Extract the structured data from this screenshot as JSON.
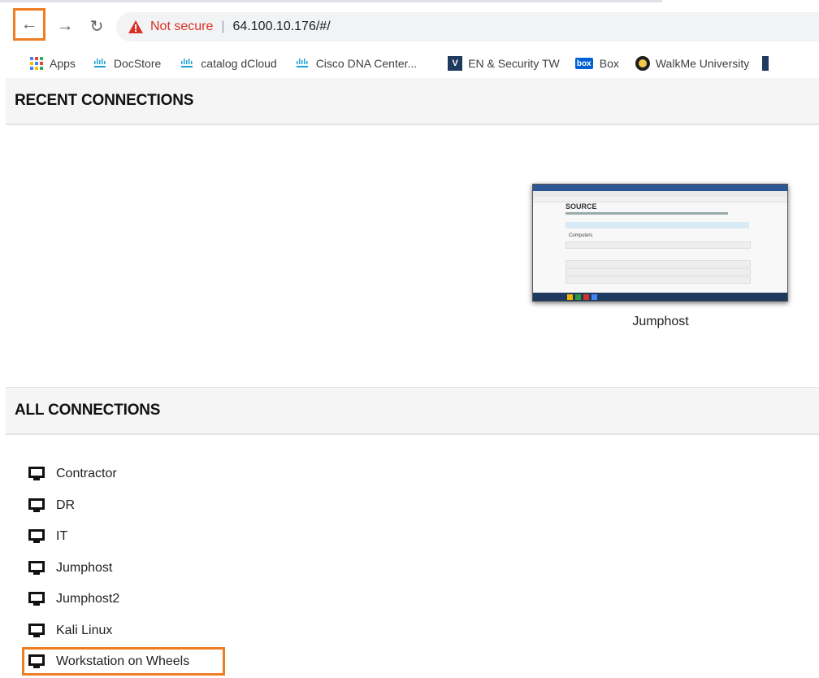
{
  "browser": {
    "security_label": "Not secure",
    "separator": "|",
    "url": "64.100.10.176/#/",
    "bookmarks": [
      {
        "label": "Apps",
        "icon": "apps-grid-icon"
      },
      {
        "label": "DocStore",
        "icon": "cisco-logo-icon"
      },
      {
        "label": "catalog dCloud",
        "icon": "cisco-logo-icon"
      },
      {
        "label": "Cisco DNA Center...",
        "icon": "cisco-logo-icon"
      },
      {
        "label": "EN & Security TW",
        "icon": "v-logo-icon"
      },
      {
        "label": "Box",
        "icon": "box-logo-icon"
      },
      {
        "label": "WalkMe University",
        "icon": "walkme-logo-icon"
      }
    ]
  },
  "recent": {
    "title": "RECENT CONNECTIONS",
    "items": [
      {
        "label": "Jumphost",
        "thumb_logo": "SOURCE",
        "thumb_heading": "Computers"
      }
    ]
  },
  "all": {
    "title": "ALL CONNECTIONS",
    "items": [
      {
        "label": "Contractor"
      },
      {
        "label": "DR"
      },
      {
        "label": "IT"
      },
      {
        "label": "Jumphost"
      },
      {
        "label": "Jumphost2"
      },
      {
        "label": "Kali Linux"
      },
      {
        "label": "Workstation on Wheels",
        "highlighted": true
      }
    ]
  },
  "colors": {
    "highlight": "#ef7d22",
    "warning": "#d93025",
    "header_bg": "#f5f5f5"
  }
}
